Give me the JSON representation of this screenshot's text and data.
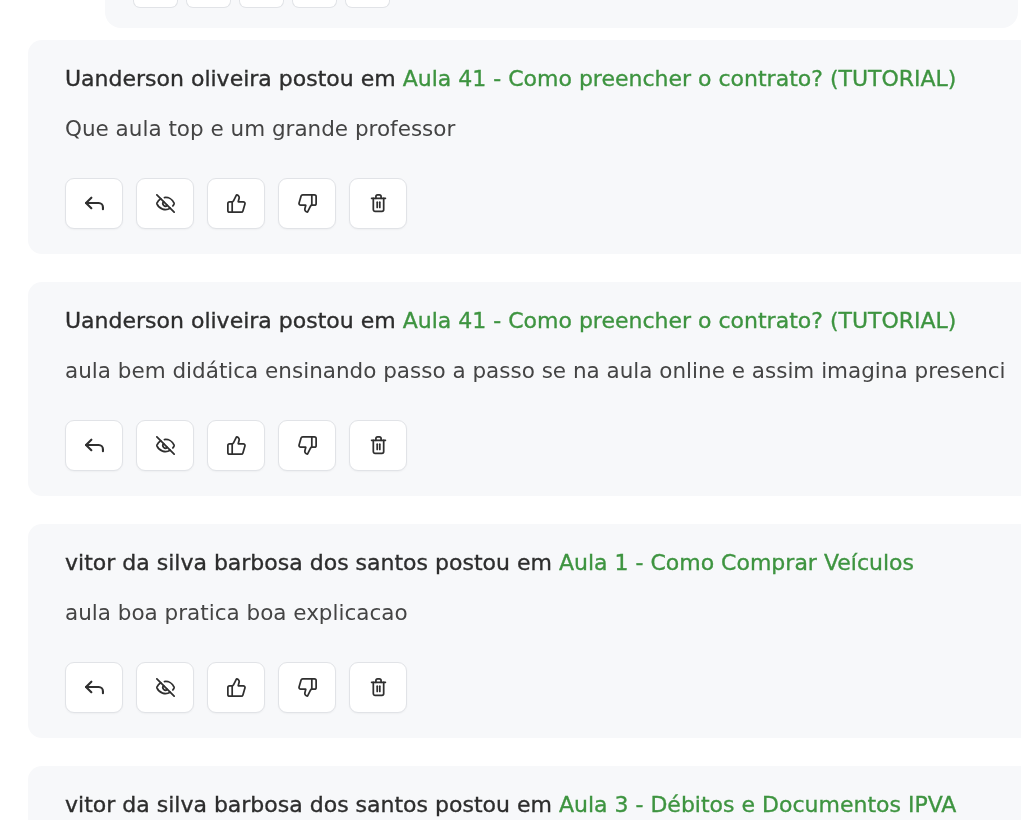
{
  "comments": [
    {
      "author": "Uanderson oliveira",
      "verb": "postou em",
      "lesson": "Aula 41 - Como preencher o contrato? (TUTORIAL)",
      "text": "Que aula top e um grande professor",
      "actions": [
        {
          "kind": "reply"
        },
        {
          "kind": "hide"
        },
        {
          "kind": "like"
        },
        {
          "kind": "dislike"
        },
        {
          "kind": "delete"
        }
      ]
    },
    {
      "author": "Uanderson oliveira",
      "verb": "postou em",
      "lesson": "Aula 41 - Como preencher o contrato? (TUTORIAL)",
      "text": "aula bem didática ensinando passo a passo se na aula online e assim imagina presenci",
      "actions": [
        {
          "kind": "reply"
        },
        {
          "kind": "hide"
        },
        {
          "kind": "like"
        },
        {
          "kind": "dislike"
        },
        {
          "kind": "delete"
        }
      ]
    },
    {
      "author": "vitor da silva barbosa dos santos",
      "verb": "postou em",
      "lesson": "Aula 1 - Como Comprar Veículos",
      "text": "aula boa pratica boa explicacao",
      "actions": [
        {
          "kind": "reply"
        },
        {
          "kind": "hide"
        },
        {
          "kind": "like"
        },
        {
          "kind": "dislike"
        },
        {
          "kind": "delete"
        }
      ]
    },
    {
      "author": "vitor da silva barbosa dos santos",
      "verb": "postou em",
      "lesson": "Aula 3 - Débitos e Documentos IPVA"
    }
  ]
}
